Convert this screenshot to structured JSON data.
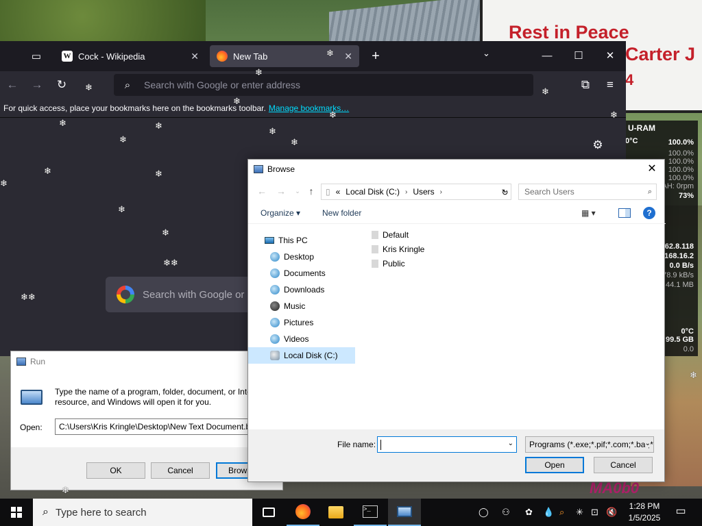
{
  "desktop": {
    "sign_line1": "Rest in Peace",
    "sign_line2": "Carter J",
    "sign_line3": "4",
    "graffiti": "MA0b0"
  },
  "firefox": {
    "tabs": [
      {
        "label": "Cock - Wikipedia",
        "favicon": "W"
      },
      {
        "label": "New Tab"
      }
    ],
    "newtab_symbol": "+",
    "url_placeholder": "Search with Google or enter address",
    "bookmarks_text": "For quick access, place your bookmarks here on the bookmarks toolbar.",
    "bookmarks_link": "Manage bookmarks…",
    "search_placeholder": "Search with Google or enter address"
  },
  "run_dialog": {
    "title": "Run",
    "description": "Type the name of a program, folder, document, or Internet resource, and Windows will open it for you.",
    "open_label": "Open:",
    "open_value": "C:\\Users\\Kris Kringle\\Desktop\\New Text Document.bat",
    "ok_label": "OK",
    "cancel_label": "Cancel",
    "browse_label": "Browse..."
  },
  "browse_dialog": {
    "title": "Browse",
    "breadcrumb": [
      "Local Disk (C:)",
      "Users"
    ],
    "breadcrumb_prefix": "«",
    "search_placeholder": "Search Users",
    "organize_label": "Organize ▾",
    "new_folder_label": "New folder",
    "tree": [
      {
        "label": "This PC"
      },
      {
        "label": "Desktop"
      },
      {
        "label": "Documents"
      },
      {
        "label": "Downloads"
      },
      {
        "label": "Music"
      },
      {
        "label": "Pictures"
      },
      {
        "label": "Videos"
      },
      {
        "label": "Local Disk (C:)",
        "selected": true
      }
    ],
    "files": [
      "Default",
      "Kris Kringle",
      "Public"
    ],
    "file_name_label": "File name:",
    "file_name_value": "",
    "filter_value": "Programs (*.exe;*.pif;*.com;*.bat;*.cmd)",
    "open_label": "Open",
    "cancel_label": "Cancel"
  },
  "widget": {
    "title": "U-RAM",
    "rows": [
      "0°C",
      "100.0%",
      "100.0%",
      "100.0%",
      "100.0%",
      "100.0%",
      "AH: 0rpm",
      "73%",
      "62.8.118",
      "168.16.2",
      "0.0 B/s",
      "78.9 kB/s",
      "44.1 MB",
      "0°C",
      "99.5 GB",
      "0.0"
    ]
  },
  "taskbar": {
    "search_placeholder": "Type here to search",
    "time": "1:28 PM",
    "date": "1/5/2025"
  },
  "colors": {
    "firefox_bg": "#1c1b22",
    "firefox_toolbar": "#2b2a33",
    "link": "#00ddff",
    "accent": "#0078d7",
    "sign_red": "#c4202a"
  }
}
